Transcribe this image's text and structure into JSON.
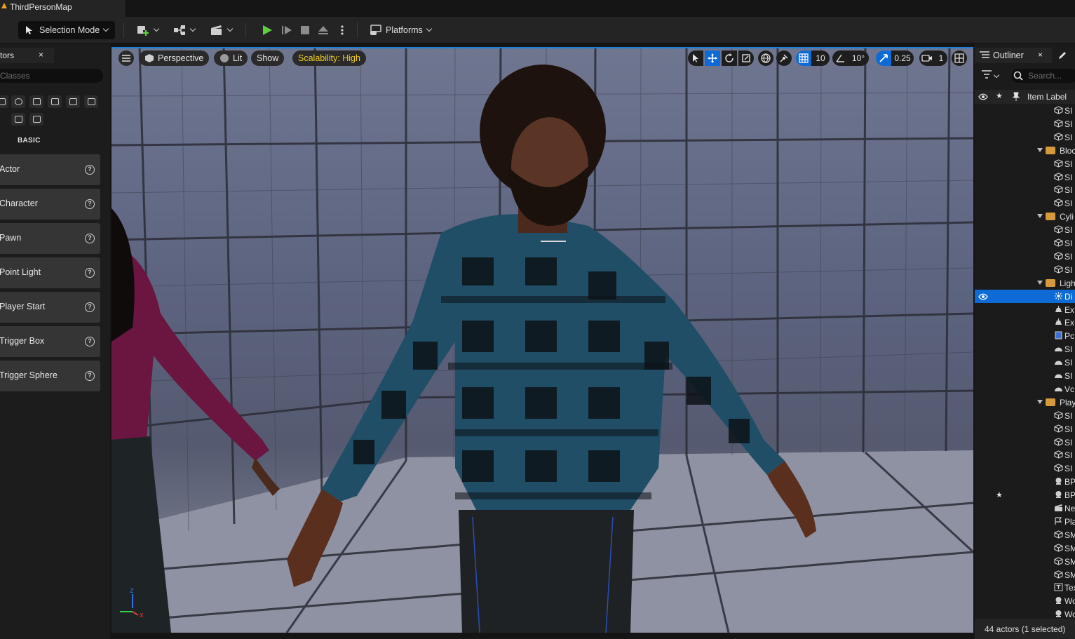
{
  "title_tab": {
    "name": "ThirdPersonMap"
  },
  "toolbar": {
    "selection_mode": "Selection Mode",
    "platforms": "Platforms"
  },
  "place_actors": {
    "tab_label": "tors",
    "close": "×",
    "search_placeholder": "Classes",
    "section": "BASIC",
    "items": [
      {
        "label": "Actor"
      },
      {
        "label": "Character"
      },
      {
        "label": "Pawn"
      },
      {
        "label": "Point Light"
      },
      {
        "label": "Player Start"
      },
      {
        "label": "Trigger Box"
      },
      {
        "label": "Trigger Sphere"
      }
    ],
    "help_glyph": "?"
  },
  "viewport": {
    "perspective": "Perspective",
    "lit": "Lit",
    "show": "Show",
    "scalability": "Scalability: High",
    "grid_snap": "10",
    "rot_snap": "10°",
    "scale_snap": "0.25",
    "camera_speed": "1",
    "axis_x": "x",
    "axis_z": "z"
  },
  "outliner": {
    "title": "Outliner",
    "close": "×",
    "search_placeholder": "Search...",
    "column_label": "Item Label",
    "rows": [
      {
        "kind": "item",
        "text": "SI",
        "icon": "mesh"
      },
      {
        "kind": "item",
        "text": "SI",
        "icon": "mesh"
      },
      {
        "kind": "item",
        "text": "SI",
        "icon": "mesh"
      },
      {
        "kind": "folder",
        "text": "Bloc"
      },
      {
        "kind": "item",
        "text": "SI",
        "icon": "mesh"
      },
      {
        "kind": "item",
        "text": "SI",
        "icon": "mesh"
      },
      {
        "kind": "item",
        "text": "SI",
        "icon": "mesh"
      },
      {
        "kind": "item",
        "text": "SI",
        "icon": "mesh"
      },
      {
        "kind": "folder",
        "text": "Cyli"
      },
      {
        "kind": "item",
        "text": "SI",
        "icon": "mesh"
      },
      {
        "kind": "item",
        "text": "SI",
        "icon": "mesh"
      },
      {
        "kind": "item",
        "text": "SI",
        "icon": "mesh"
      },
      {
        "kind": "item",
        "text": "SI",
        "icon": "mesh"
      },
      {
        "kind": "folder",
        "text": "Ligh"
      },
      {
        "kind": "item",
        "text": "Di",
        "icon": "light",
        "selected": true
      },
      {
        "kind": "item",
        "text": "Ex",
        "icon": "fog"
      },
      {
        "kind": "item",
        "text": "Ex",
        "icon": "fog"
      },
      {
        "kind": "item",
        "text": "Pc",
        "icon": "volume"
      },
      {
        "kind": "item",
        "text": "SI",
        "icon": "sky"
      },
      {
        "kind": "item",
        "text": "SI",
        "icon": "sky"
      },
      {
        "kind": "item",
        "text": "SI",
        "icon": "sky"
      },
      {
        "kind": "item",
        "text": "Vc",
        "icon": "sky"
      },
      {
        "kind": "folder",
        "text": "Play"
      },
      {
        "kind": "item",
        "text": "SI",
        "icon": "mesh"
      },
      {
        "kind": "item",
        "text": "SI",
        "icon": "mesh"
      },
      {
        "kind": "item",
        "text": "SI",
        "icon": "mesh"
      },
      {
        "kind": "item",
        "text": "SI",
        "icon": "mesh"
      },
      {
        "kind": "item",
        "text": "SI",
        "icon": "mesh"
      },
      {
        "kind": "item",
        "text": "BP_",
        "icon": "pawn"
      },
      {
        "kind": "item",
        "text": "BP_",
        "icon": "pawn",
        "starred": true
      },
      {
        "kind": "item",
        "text": "New",
        "icon": "clapper"
      },
      {
        "kind": "item",
        "text": "Play",
        "icon": "flag"
      },
      {
        "kind": "item",
        "text": "SM_",
        "icon": "mesh"
      },
      {
        "kind": "item",
        "text": "SM_",
        "icon": "mesh"
      },
      {
        "kind": "item",
        "text": "SM_",
        "icon": "mesh"
      },
      {
        "kind": "item",
        "text": "SM_",
        "icon": "mesh"
      },
      {
        "kind": "item",
        "text": "Tex",
        "icon": "text"
      },
      {
        "kind": "item",
        "text": "Wor",
        "icon": "pawn"
      },
      {
        "kind": "item",
        "text": "Wor",
        "icon": "pawn"
      }
    ],
    "status": "44 actors (1 selected)",
    "star_glyph": "★"
  },
  "colors": {
    "accent": "#0e6bd6",
    "play": "#5ccf3a",
    "scalability_text": "#f0d020",
    "folder": "#d69a3c"
  }
}
